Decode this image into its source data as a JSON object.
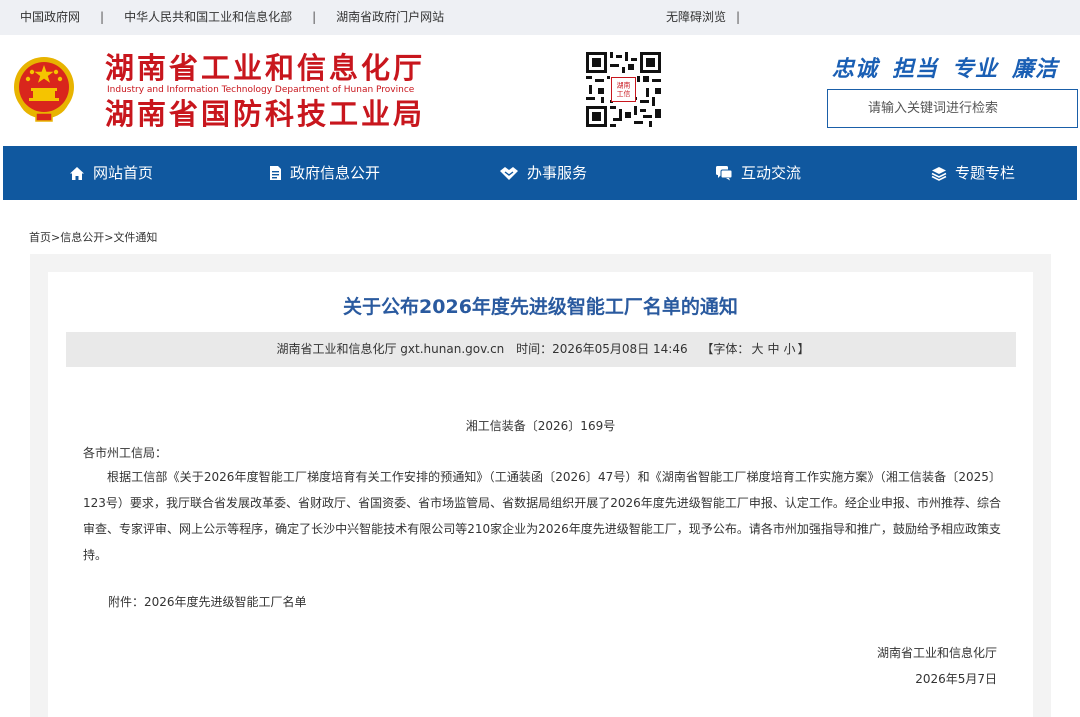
{
  "topbar": {
    "links": [
      "中国政府网",
      "中华人民共和国工业和信息化部",
      "湖南省政府门户网站"
    ],
    "separator": "|",
    "accessibility": "无障碍浏览"
  },
  "header": {
    "title_line1": "湖南省工业和信息化厅",
    "title_en": "Industry and Information Technology Department of Hunan Province",
    "title_line2": "湖南省国防科技工业局",
    "qr_label": "湖南工信",
    "slogans": [
      "忠诚",
      "担当",
      "专业",
      "廉洁"
    ],
    "search_placeholder": "请输入关键词进行检索"
  },
  "nav": {
    "items": [
      {
        "label": "网站首页",
        "icon": "home-icon"
      },
      {
        "label": "政府信息公开",
        "icon": "document-icon"
      },
      {
        "label": "办事服务",
        "icon": "handshake-icon"
      },
      {
        "label": "互动交流",
        "icon": "chat-icon"
      },
      {
        "label": "专题专栏",
        "icon": "layers-icon"
      }
    ]
  },
  "breadcrumb": {
    "items": [
      "首页",
      "信息公开",
      "文件通知"
    ],
    "separator": ">"
  },
  "article": {
    "title": "关于公布2026年度先进级智能工厂名单的通知",
    "meta_source": "湖南省工业和信息化厅 gxt.hunan.gov.cn",
    "meta_time_label": "时间：2026年05月08日 14:46",
    "meta_font_label": "【字体：",
    "font_sizes": [
      "大",
      "中",
      "小"
    ],
    "meta_font_close": "】",
    "doc_number": "湘工信装备〔2026〕169号",
    "addressee": "各市州工信局：",
    "body": "根据工信部《关于2026年度智能工厂梯度培育有关工作安排的预通知》（工通装函〔2026〕47号）和《湖南省智能工厂梯度培育工作实施方案》（湘工信装备〔2025〕123号）要求，我厅联合省发展改革委、省财政厅、省国资委、省市场监管局、省数据局组织开展了2026年度先进级智能工厂申报、认定工作。经企业申报、市州推荐、综合审查、专家评审、网上公示等程序，确定了长沙中兴智能技术有限公司等210家企业为2026年度先进级智能工厂，现予公布。请各市州加强指导和推广，鼓励给予相应政策支持。",
    "attachment": "附件：2026年度先进级智能工厂名单",
    "signature_org": "湖南省工业和信息化厅",
    "signature_date": "2026年5月7日"
  },
  "colors": {
    "nav_bg": "#10589f",
    "title_red": "#c8161d",
    "article_title_blue": "#2a5a9f",
    "slogan_blue": "#1a5fb4"
  }
}
